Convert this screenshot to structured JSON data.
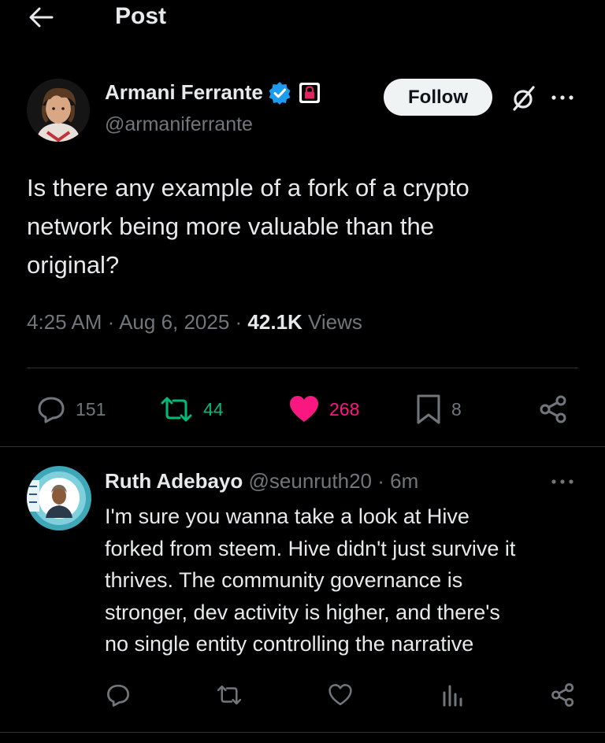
{
  "header": {
    "title": "Post",
    "back_icon": "arrow-left-icon"
  },
  "author": {
    "name": "Armani Ferrante",
    "handle": "@armaniferrante",
    "verified_icon": "verified-badge-icon",
    "affiliate_icon": "lock-badge-icon",
    "follow_label": "Follow"
  },
  "tweet": {
    "text_lines": [
      "Is there any example of a fork of a crypto",
      "network being more valuable than the",
      "original?"
    ],
    "time": "4:25 AM",
    "sep1": " · ",
    "date": "Aug 6, 2025",
    "sep2": " · ",
    "views_count": "42.1K",
    "views_label": " Views"
  },
  "actions": {
    "replies": "151",
    "reposts": "44",
    "likes": "268",
    "bookmarks": "8"
  },
  "reply": {
    "name": "Ruth Adebayo",
    "handle": "@seunruth20",
    "sep": " · ",
    "time": "6m",
    "text_lines": [
      "I'm sure you wanna take a look at Hive",
      "forked from steem. Hive didn't just survive it",
      "thrives. The community governance is",
      "stronger, dev activity is higher, and there's",
      "no single entity controlling the narrative"
    ]
  },
  "colors": {
    "background": "#000000",
    "text": "#e7e9ea",
    "muted": "#71767b",
    "verified": "#1d9bf0",
    "repost": "#00ba7c",
    "like": "#f91880",
    "divider": "#2f3336"
  }
}
